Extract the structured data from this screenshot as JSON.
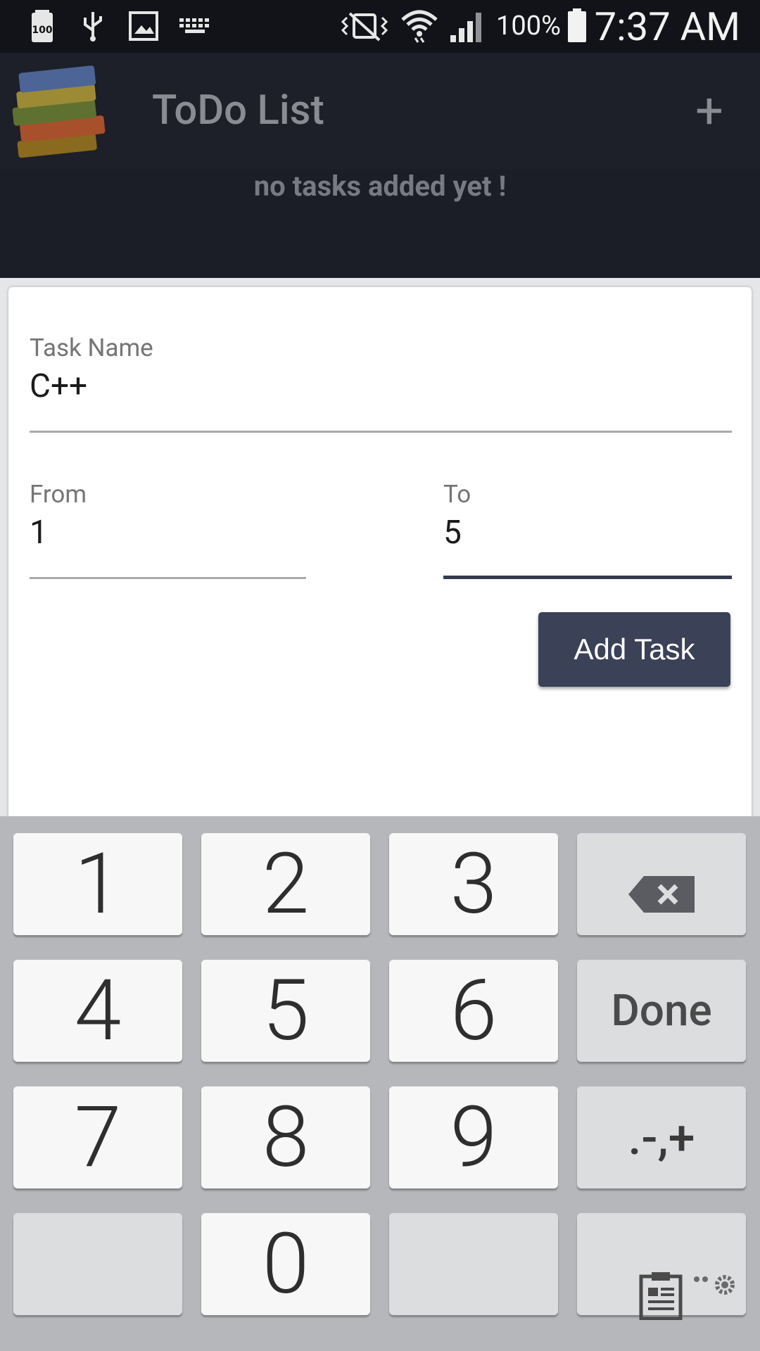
{
  "status_bar": {
    "battery_small_label": "100",
    "battery_percent": "100%",
    "time": "7:37 AM",
    "icons": [
      "battery-100-icon",
      "usb-icon",
      "image-icon",
      "keyboard-icon",
      "vibrate-icon",
      "wifi-icon",
      "signal-icon",
      "battery-icon"
    ]
  },
  "app_bar": {
    "title": "ToDo List",
    "logo_icon": "books-logo-icon",
    "add_icon": "plus-icon",
    "add_symbol": "+"
  },
  "empty_message": "no tasks added yet !",
  "dialog": {
    "task_name": {
      "label": "Task Name",
      "value": "C++"
    },
    "from": {
      "label": "From",
      "value": "1"
    },
    "to": {
      "label": "To",
      "value": "5"
    },
    "add_button": "Add Task"
  },
  "keyboard": {
    "row1": [
      "1",
      "2",
      "3"
    ],
    "row2": [
      "4",
      "5",
      "6"
    ],
    "row3": [
      "7",
      "8",
      "9"
    ],
    "row4_center": "0",
    "done_label": "Done",
    "symbols_label": ".-,+",
    "backspace_icon": "backspace-icon",
    "clipboard_icon": "clipboard-icon",
    "settings_icon": "gear-icon"
  },
  "colors": {
    "app_bar_bg": "#1d1f29",
    "primary_button": "#3b4157",
    "focused_underline": "#353b4d"
  }
}
